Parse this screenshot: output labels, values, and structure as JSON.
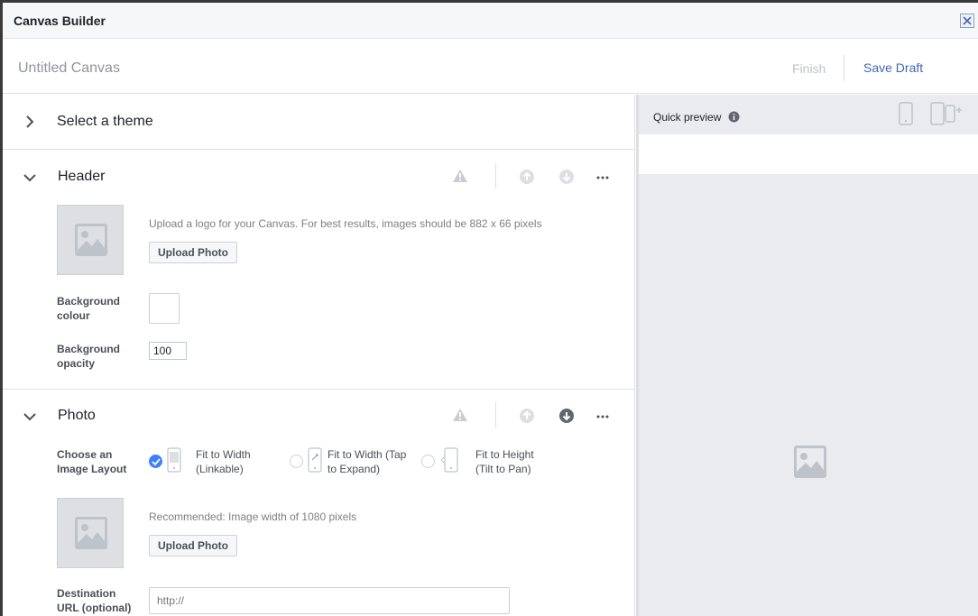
{
  "window": {
    "title": "Canvas Builder"
  },
  "toolbar": {
    "canvas_name": "Untitled Canvas",
    "finish_label": "Finish",
    "save_draft_label": "Save Draft"
  },
  "theme": {
    "label": "Select a theme"
  },
  "header_section": {
    "label": "Header",
    "upload_hint": "Upload a logo for your Canvas. For best results, images should be 882 x 66 pixels",
    "upload_label": "Upload Photo",
    "bg_colour_label_1": "Background",
    "bg_colour_label_2": "colour",
    "bg_opacity_label_1": "Background",
    "bg_opacity_label_2": "opacity",
    "bg_opacity_value": "100"
  },
  "photo_section": {
    "label": "Photo",
    "layout_label_1": "Choose an",
    "layout_label_2": "Image Layout",
    "options": [
      {
        "line1": "Fit to Width",
        "line2": "(Linkable)",
        "selected": true
      },
      {
        "line1": "Fit to Width (Tap",
        "line2": "to Expand)",
        "selected": false
      },
      {
        "line1": "Fit to Height",
        "line2": "(Tilt to Pan)",
        "selected": false
      }
    ],
    "upload_hint": "Recommended: Image width of 1080 pixels",
    "upload_label": "Upload Photo",
    "url_label_1": "Destination",
    "url_label_2": "URL (optional)",
    "url_placeholder": "http://"
  },
  "preview": {
    "title": "Quick preview"
  },
  "colors": {
    "accent": "#4267b2",
    "selected_radio": "#4080ff",
    "panel_bg": "#e9ebee"
  },
  "icons": [
    "close-icon",
    "chevron-right-icon",
    "chevron-down-icon",
    "warning-icon",
    "move-up-icon",
    "move-down-icon",
    "more-icon",
    "image-placeholder-icon",
    "phone-icon",
    "phone-plus-icon",
    "info-icon",
    "check-icon"
  ]
}
